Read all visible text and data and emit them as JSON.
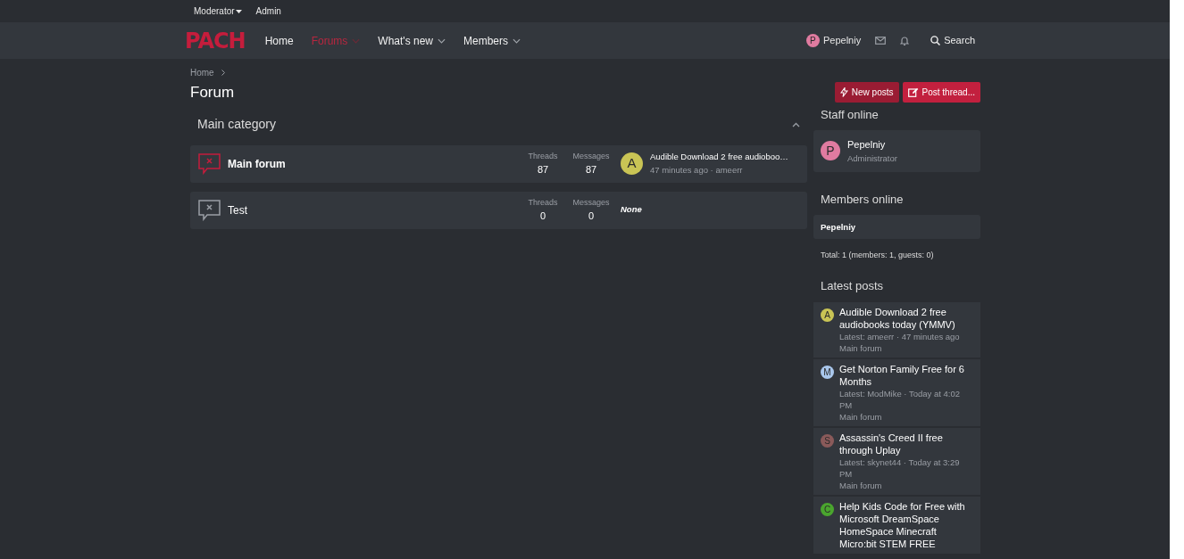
{
  "top_bar": {
    "items": [
      {
        "label": "Moderator",
        "dropdown": true
      },
      {
        "label": "Admin",
        "dropdown": false
      }
    ]
  },
  "navbar": {
    "logo": "PACH",
    "tabs": [
      {
        "label": "Home",
        "selected": false,
        "dropdown": false
      },
      {
        "label": "Forums",
        "selected": true,
        "dropdown": true
      },
      {
        "label": "What's new",
        "selected": false,
        "dropdown": true
      },
      {
        "label": "Members",
        "selected": false,
        "dropdown": true
      }
    ],
    "user": {
      "avatar": "P",
      "color": "#e07ba0",
      "name": "Pepelniy"
    },
    "search": "Search"
  },
  "breadcrumb": [
    "Home"
  ],
  "title": "Forum",
  "actions": [
    {
      "label": "New posts",
      "kind": "new"
    },
    {
      "label": "Post thread...",
      "kind": "post"
    }
  ],
  "category": {
    "title": "Main category",
    "expanded": true,
    "forums": [
      {
        "name": "Main forum",
        "unread": true,
        "threads_label": "Threads",
        "threads": "87",
        "messages_label": "Messages",
        "messages": "87",
        "last": {
          "avatar": "A",
          "color": "#c9c455",
          "title": "Audible Download 2 free audioboo…",
          "meta": "47 minutes ago · ameerr"
        }
      },
      {
        "name": "Test",
        "unread": false,
        "threads_label": "Threads",
        "threads": "0",
        "messages_label": "Messages",
        "messages": "0",
        "none": "None"
      }
    ]
  },
  "sidebar": {
    "staff": {
      "title": "Staff online",
      "members": [
        {
          "avatar": "P",
          "color": "#e07ba0",
          "name": "Pepelniy",
          "role": "Administrator"
        }
      ]
    },
    "online": {
      "title": "Members online",
      "members": [
        "Pepelniy"
      ],
      "total": "Total: 1 (members: 1, guests: 0)"
    },
    "latest": {
      "title": "Latest posts",
      "posts": [
        {
          "avatar": "A",
          "color": "#c9c455",
          "title": "Audible Download 2 free audiobooks today (YMMV)",
          "meta": "Latest: ameerr · 47 minutes ago",
          "forum": "Main forum"
        },
        {
          "avatar": "M",
          "color": "#a9c7ec",
          "title": "Get Norton Family Free for 6 Months",
          "meta": "Latest: ModMike · Today at 4:02 PM",
          "forum": "Main forum"
        },
        {
          "avatar": "S",
          "color": "#8a5a5a",
          "title": "Assassin's Creed II free through Uplay",
          "meta": "Latest: skynet44 · Today at 3:29 PM",
          "forum": "Main forum"
        },
        {
          "avatar": "C",
          "color": "#4aa52e",
          "title": "Help Kids Code for Free with Microsoft DreamSpace HomeSpace Minecraft Micro:bit STEM FREE"
        }
      ]
    }
  }
}
